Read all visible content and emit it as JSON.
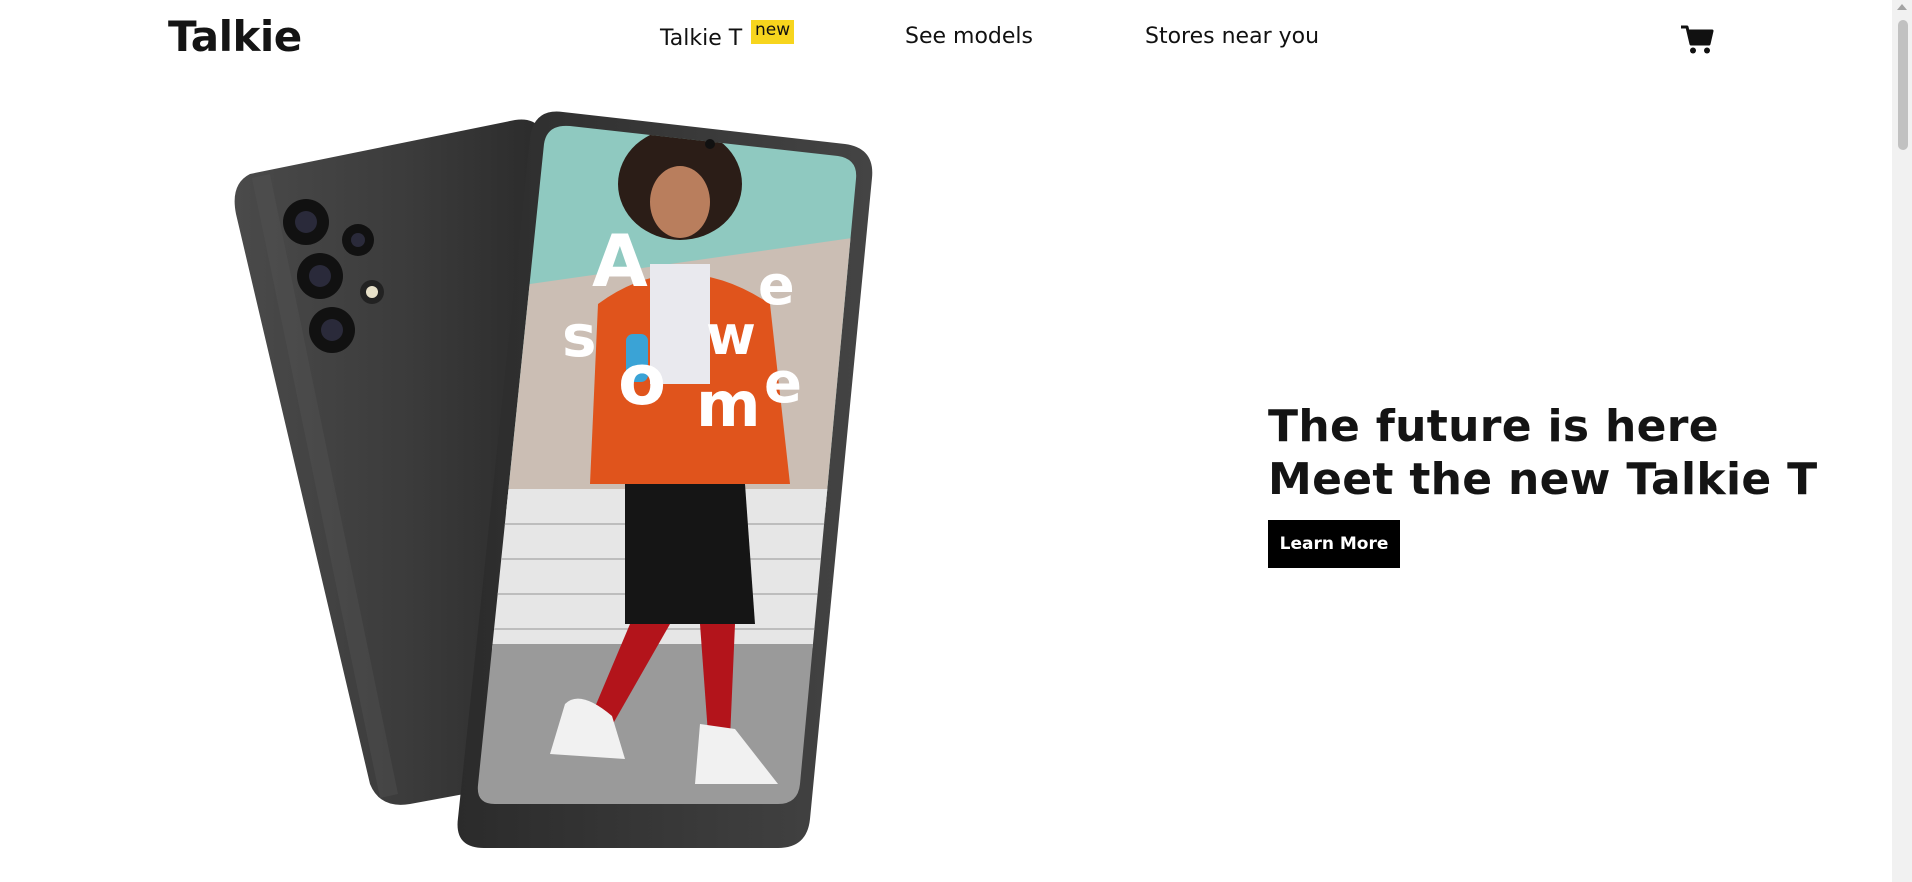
{
  "header": {
    "logo": "Talkie",
    "nav": [
      {
        "label": "Talkie T",
        "badge": "new"
      },
      {
        "label": "See models"
      },
      {
        "label": "Stores near you"
      }
    ],
    "cart_icon": "shopping-cart-icon"
  },
  "hero": {
    "screen_text": [
      "A",
      "w",
      "e",
      "s",
      "o",
      "m",
      "e"
    ],
    "headline_line1": "The future is here",
    "headline_line2": "Meet the new Talkie T",
    "button_label": "Learn More"
  },
  "colors": {
    "badge": "#f7d51d",
    "button_bg": "#000000",
    "phone_body": "#3a3a3a",
    "screen_teal": "#8fc9c0"
  }
}
